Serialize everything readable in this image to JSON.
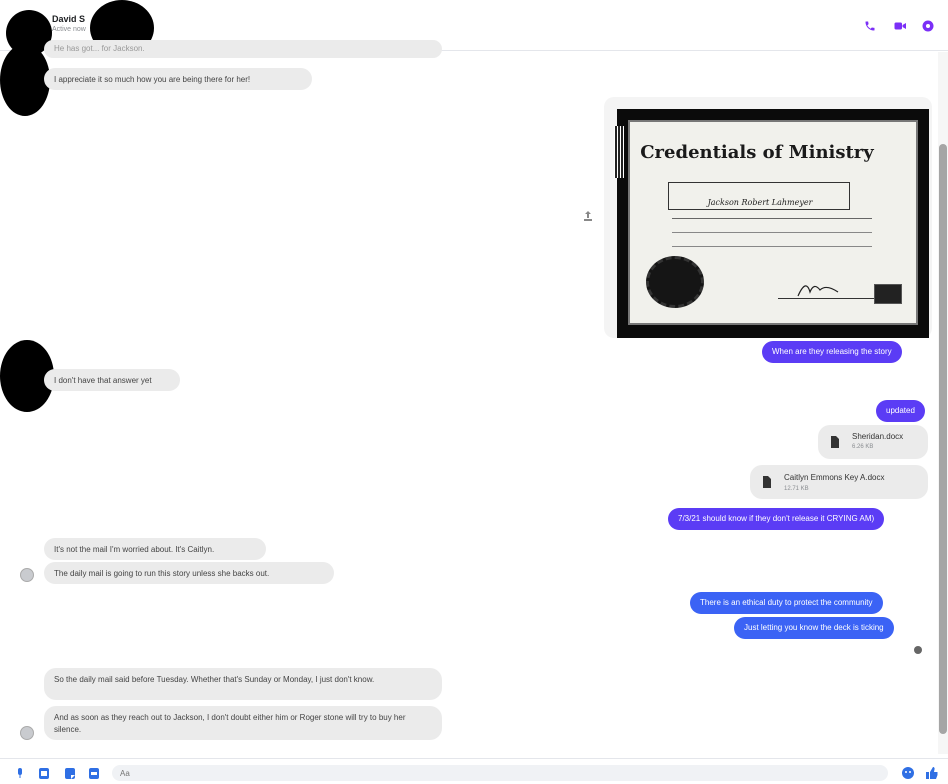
{
  "header": {
    "contact_name": "David S",
    "status": "Active now",
    "icons": [
      "phone-icon",
      "video-icon",
      "info-icon"
    ]
  },
  "thread": {
    "partial_top": "He has got... for Jackson.",
    "in_1": "I appreciate it so much how you are being there for her!",
    "in_2": "I don't have that answer yet",
    "out_release": "When are they releasing the story",
    "out_updated": "updated",
    "file_1": {
      "name": "Sheridan.docx",
      "size": "6.26 KB"
    },
    "file_2": {
      "name": "Caitlyn Emmons Key A.docx",
      "size": "12.71 KB"
    },
    "out_should_know": "7/3/21 should know if they don't release it CRYING AM)",
    "in_3": "It's not the mail I'm worried about. It's Caitlyn.",
    "in_4": "The daily mail is going to run this story unless she backs out.",
    "out_ethical": "There is an ethical duty to protect the community",
    "out_letting": "Just letting you know the deck is ticking",
    "in_5": "So the daily mail said before Tuesday. Whether that's Sunday or Monday, I just don't know.",
    "in_6": "And as soon as they reach out to Jackson, I don't doubt either him or Roger stone will try to buy her silence."
  },
  "certificate": {
    "title": "Credentials of Ministry",
    "subtitle": "Jackson Robert Lahmeyer"
  },
  "composer": {
    "placeholder": "Aa",
    "icons": [
      "mic-icon",
      "image-icon",
      "sticker-icon",
      "gif-icon",
      "emoji-icon",
      "like-icon"
    ]
  },
  "colors": {
    "accent": "#7b2ff7",
    "outgoing": "#5b3cf5",
    "incoming": "#ebebeb"
  }
}
